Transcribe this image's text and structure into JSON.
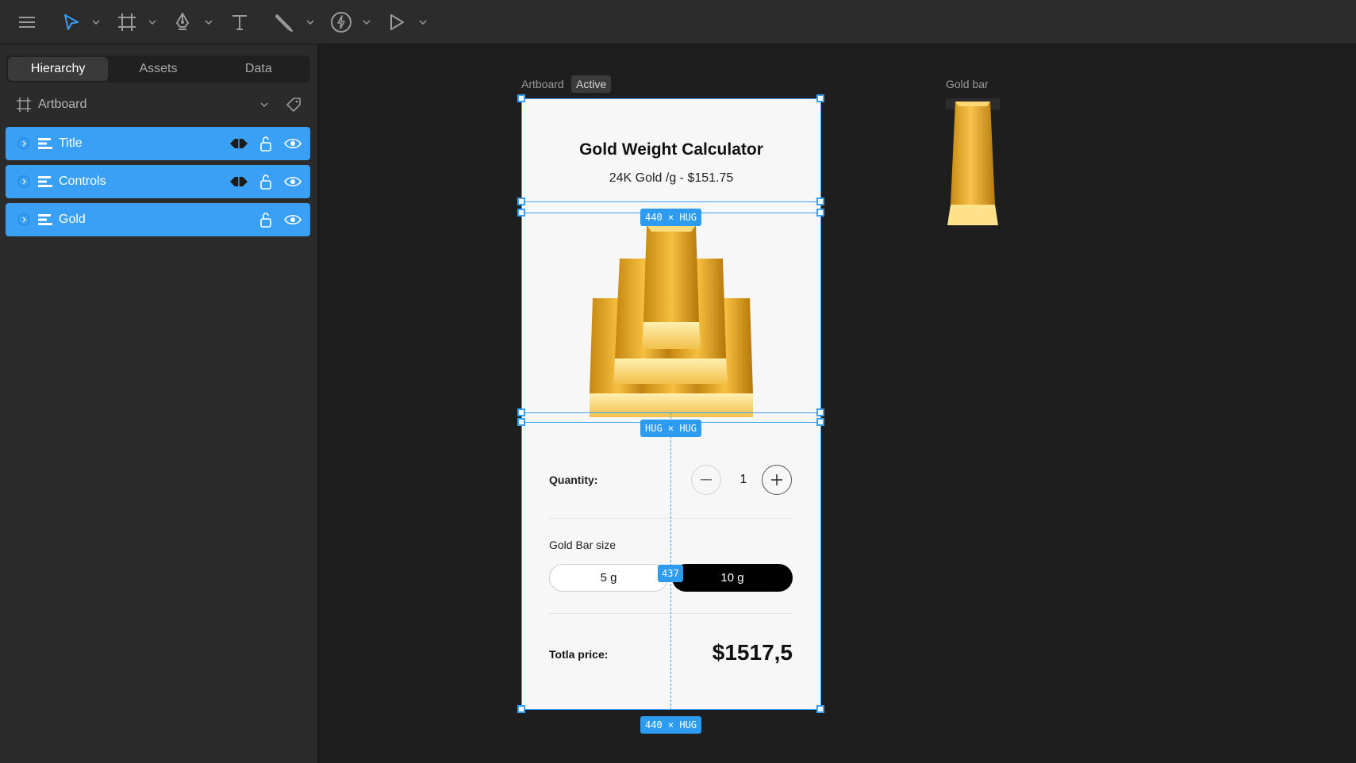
{
  "toolbar": {
    "tools": [
      {
        "name": "menu-icon"
      },
      {
        "name": "select-tool-icon"
      },
      {
        "name": "frame-tool-icon"
      },
      {
        "name": "pen-tool-icon"
      },
      {
        "name": "text-tool-icon"
      },
      {
        "name": "pencil-tool-icon"
      },
      {
        "name": "interaction-tool-icon"
      },
      {
        "name": "play-icon"
      }
    ],
    "accent": "#3aa0f5"
  },
  "sidebar": {
    "tabs": [
      "Hierarchy",
      "Assets",
      "Data"
    ],
    "active_tab": "Hierarchy",
    "artboard_label": "Artboard",
    "layers": [
      {
        "name": "Title",
        "has_mask_icon": true
      },
      {
        "name": "Controls",
        "has_mask_icon": true
      },
      {
        "name": "Gold",
        "has_mask_icon": false
      }
    ]
  },
  "canvas": {
    "artboard_label": "Artboard",
    "artboard_badge": "Active",
    "asset_label": "Gold bar",
    "dimension_top": "440 × HUG",
    "dimension_middle": "HUG × HUG",
    "dimension_bottom": "440 × HUG",
    "measure": "437"
  },
  "app": {
    "title": "Gold Weight Calculator",
    "subtitle": "24K Gold /g - $151.75",
    "quantity_label": "Quantity:",
    "quantity_value": "1",
    "size_label": "Gold Bar size",
    "size_options": [
      "5 g",
      "10 g"
    ],
    "selected_size": "10 g",
    "total_label": "Totla price:",
    "total_value": "$1517,5"
  },
  "colors": {
    "selection": "#3aa0f5",
    "gold": "#f2b531",
    "layer_bg": "#3aa0f5"
  }
}
